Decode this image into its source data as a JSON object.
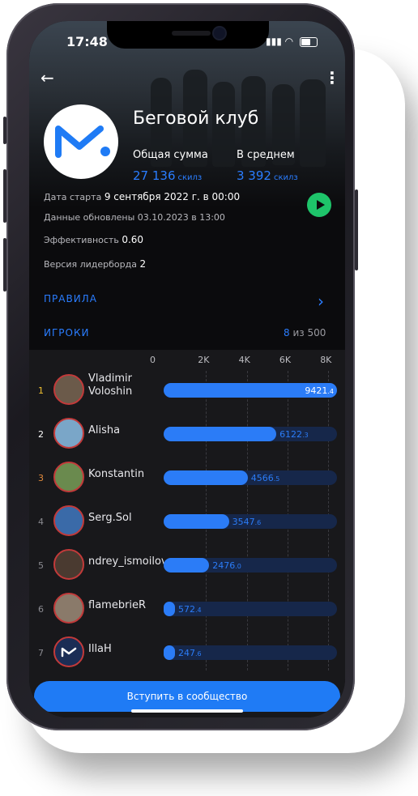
{
  "status": {
    "time": "17:48"
  },
  "club": {
    "title": "Беговой клуб",
    "total_label": "Общая сумма",
    "total_value": "27 136",
    "total_unit": "скилз",
    "avg_label": "В среднем",
    "avg_value": "3 392",
    "avg_unit": "скилз"
  },
  "info": {
    "start_label": "Дата старта",
    "start_value": "9 сентября 2022 г. в 00:00",
    "updated": "Данные обновлены 03.10.2023 в 13:00",
    "efficiency_label": "Эффективность",
    "efficiency_value": "0.60",
    "version_label": "Версия лидерборда",
    "version_value": "2"
  },
  "links": {
    "rules": "ПРАВИЛА",
    "players": "ИГРОКИ",
    "players_count": "8",
    "players_of": "из 500"
  },
  "axis": [
    "0",
    "2K",
    "4K",
    "6K",
    "8K"
  ],
  "leaderboard": [
    {
      "rank": "1",
      "name_line1": "Vladimir",
      "name_line2": "Voloshin",
      "int": "9421",
      "dec": ".4",
      "value": 9421.4,
      "rank_color": "#f2c230"
    },
    {
      "rank": "2",
      "name_line1": "Alisha",
      "name_line2": "",
      "int": "6122",
      "dec": ".3",
      "value": 6122.3,
      "rank_color": "#ffffff"
    },
    {
      "rank": "3",
      "name_line1": "Konstantin",
      "name_line2": "",
      "int": "4566",
      "dec": ".5",
      "value": 4566.5,
      "rank_color": "#e08a3c"
    },
    {
      "rank": "4",
      "name_line1": "Serg.Sol",
      "name_line2": "",
      "int": "3547",
      "dec": ".6",
      "value": 3547.6,
      "rank_color": "#8a8a90"
    },
    {
      "rank": "5",
      "name_line1": "ndrey_ismoilov",
      "name_line2": "",
      "int": "2476",
      "dec": ".0",
      "value": 2476.0,
      "rank_color": "#8a8a90"
    },
    {
      "rank": "6",
      "name_line1": "flamebrieR",
      "name_line2": "",
      "int": "572",
      "dec": ".4",
      "value": 572.4,
      "rank_color": "#8a8a90"
    },
    {
      "rank": "7",
      "name_line1": "IllaH",
      "name_line2": "",
      "int": "247",
      "dec": ".6",
      "value": 247.6,
      "rank_color": "#8a8a90"
    }
  ],
  "join_button": "Вступить в сообщество",
  "colors": {
    "accent": "#2b7cf7",
    "bar_track": "#16274a",
    "play": "#1ec46a"
  }
}
